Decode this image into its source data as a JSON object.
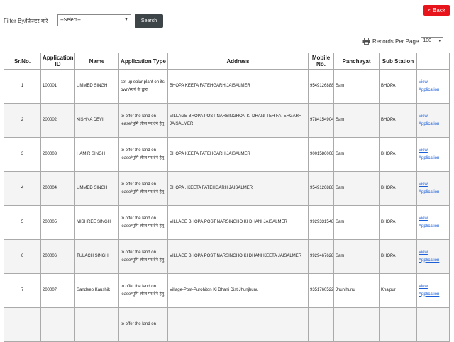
{
  "header": {
    "back_label": "< Back",
    "filter_label": "Filter By/फ़िल्टर करे",
    "filter_select_value": "--Select--",
    "search_label": "Search",
    "records_per_page_label": "Records Per Page",
    "records_per_page_value": "100"
  },
  "table": {
    "columns": [
      "Sr.No.",
      "Application ID",
      "Name",
      "Application Type",
      "Address",
      "Mobile No.",
      "Panchayat",
      "Sub Station",
      ""
    ],
    "link_label": "View Application",
    "rows": [
      {
        "sr": "1",
        "app_id": "100001",
        "name": "UMMED SINGH",
        "type": "set up solar plant on its own/स्वयं के द्वारा",
        "address": "BHOPA KEETA FATEHGARH JAISALMER",
        "mobile": "9549126888",
        "panchayat": "Sam",
        "substation": "BHOPA"
      },
      {
        "sr": "2",
        "app_id": "200002",
        "name": "KISHNA DEVI",
        "type": "to offer the land on lease/भूमि लीज पर देने हेतु",
        "address": "VILLAGE BHOPA POST NARSINGHON KI DHANI TEH FATEHGARH JAISALMER",
        "mobile": "9784154904",
        "panchayat": "Sam",
        "substation": "BHOPA"
      },
      {
        "sr": "3",
        "app_id": "200003",
        "name": "HAMIR SINGH",
        "type": "to offer the land on lease/भूमि लीज पर देने हेतु",
        "address": "BHOPA KEETA FATEHGARH JAISALMER",
        "mobile": "9001586008",
        "panchayat": "Sam",
        "substation": "BHOPA"
      },
      {
        "sr": "4",
        "app_id": "200004",
        "name": "UMMED SINGH",
        "type": "to offer the land on lease/भूमि लीज पर देने हेतु",
        "address": "BHOPA , KEETA FATEHGARH JAISALMER",
        "mobile": "9549126888",
        "panchayat": "Sam",
        "substation": "BHOPA"
      },
      {
        "sr": "5",
        "app_id": "200005",
        "name": "MISHREE SINGH",
        "type": "to offer the land on lease/भूमि लीज पर देने हेतु",
        "address": "VILLAGE BHOPA,POST NARSINGHO KI DHANI JAISALMER",
        "mobile": "9929331548",
        "panchayat": "Sam",
        "substation": "BHOPA"
      },
      {
        "sr": "6",
        "app_id": "200006",
        "name": "TULACH SINGH",
        "type": "to offer the land on lease/भूमि लीज पर देने हेतु",
        "address": "VILLAGE BHOPA POST NARSINGHO KI DHANI KEETA JAISALMER",
        "mobile": "9929467628",
        "panchayat": "Sam",
        "substation": "BHOPA"
      },
      {
        "sr": "7",
        "app_id": "200007",
        "name": "Sandeep Kaushik",
        "type": "to offer the land on lease/भूमि लीज पर देने हेतु",
        "address": "Village-Post-Purohiton Ki Dhani Dist Jhunjhunu",
        "mobile": "9351760522",
        "panchayat": "Jhunjhunu",
        "substation": "Khajpur"
      },
      {
        "sr": "",
        "app_id": "",
        "name": "",
        "type": "to offer the land on",
        "address": "",
        "mobile": "",
        "panchayat": "",
        "substation": ""
      }
    ]
  }
}
